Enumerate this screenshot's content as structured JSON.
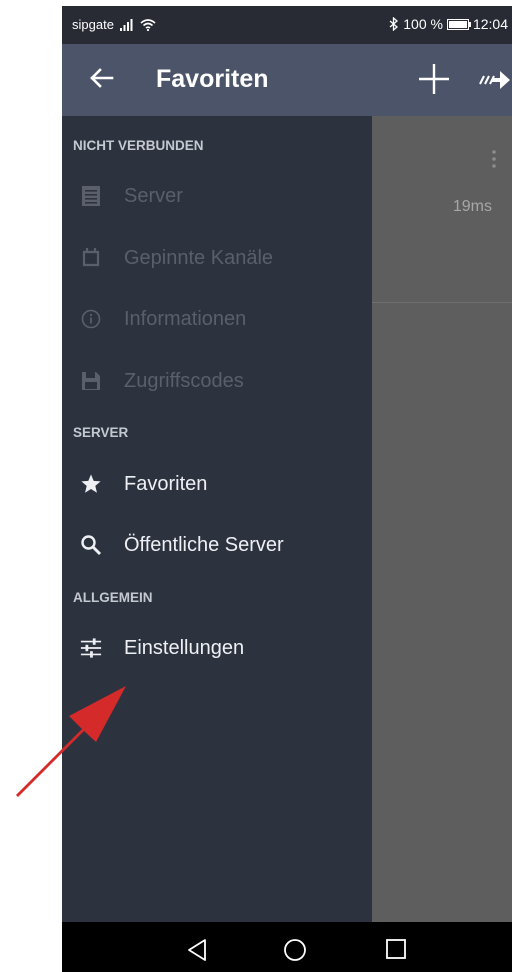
{
  "status_bar": {
    "carrier": "sipgate",
    "battery": "100 %",
    "time": "12:04"
  },
  "toolbar": {
    "title": "Favoriten"
  },
  "background_content": {
    "ping": "19ms"
  },
  "drawer": {
    "sections": [
      {
        "title": "NICHT VERBUNDEN",
        "items": [
          {
            "label": "Server",
            "icon": "server-list-icon",
            "enabled": false
          },
          {
            "label": "Gepinnte Kanäle",
            "icon": "pin-icon",
            "enabled": false
          },
          {
            "label": "Informationen",
            "icon": "info-icon",
            "enabled": false
          },
          {
            "label": "Zugriffscodes",
            "icon": "save-icon",
            "enabled": false
          }
        ]
      },
      {
        "title": "SERVER",
        "items": [
          {
            "label": "Favoriten",
            "icon": "star-icon",
            "enabled": true
          },
          {
            "label": "Öffentliche Server",
            "icon": "search-icon",
            "enabled": true
          }
        ]
      },
      {
        "title": "ALLGEMEIN",
        "items": [
          {
            "label": "Einstellungen",
            "icon": "settings-sliders-icon",
            "enabled": true
          }
        ]
      }
    ]
  },
  "colors": {
    "toolbar": "#4c5469",
    "drawer": "#2d323f",
    "status_bar": "#282b34",
    "annotation_arrow": "#d42a2a"
  }
}
